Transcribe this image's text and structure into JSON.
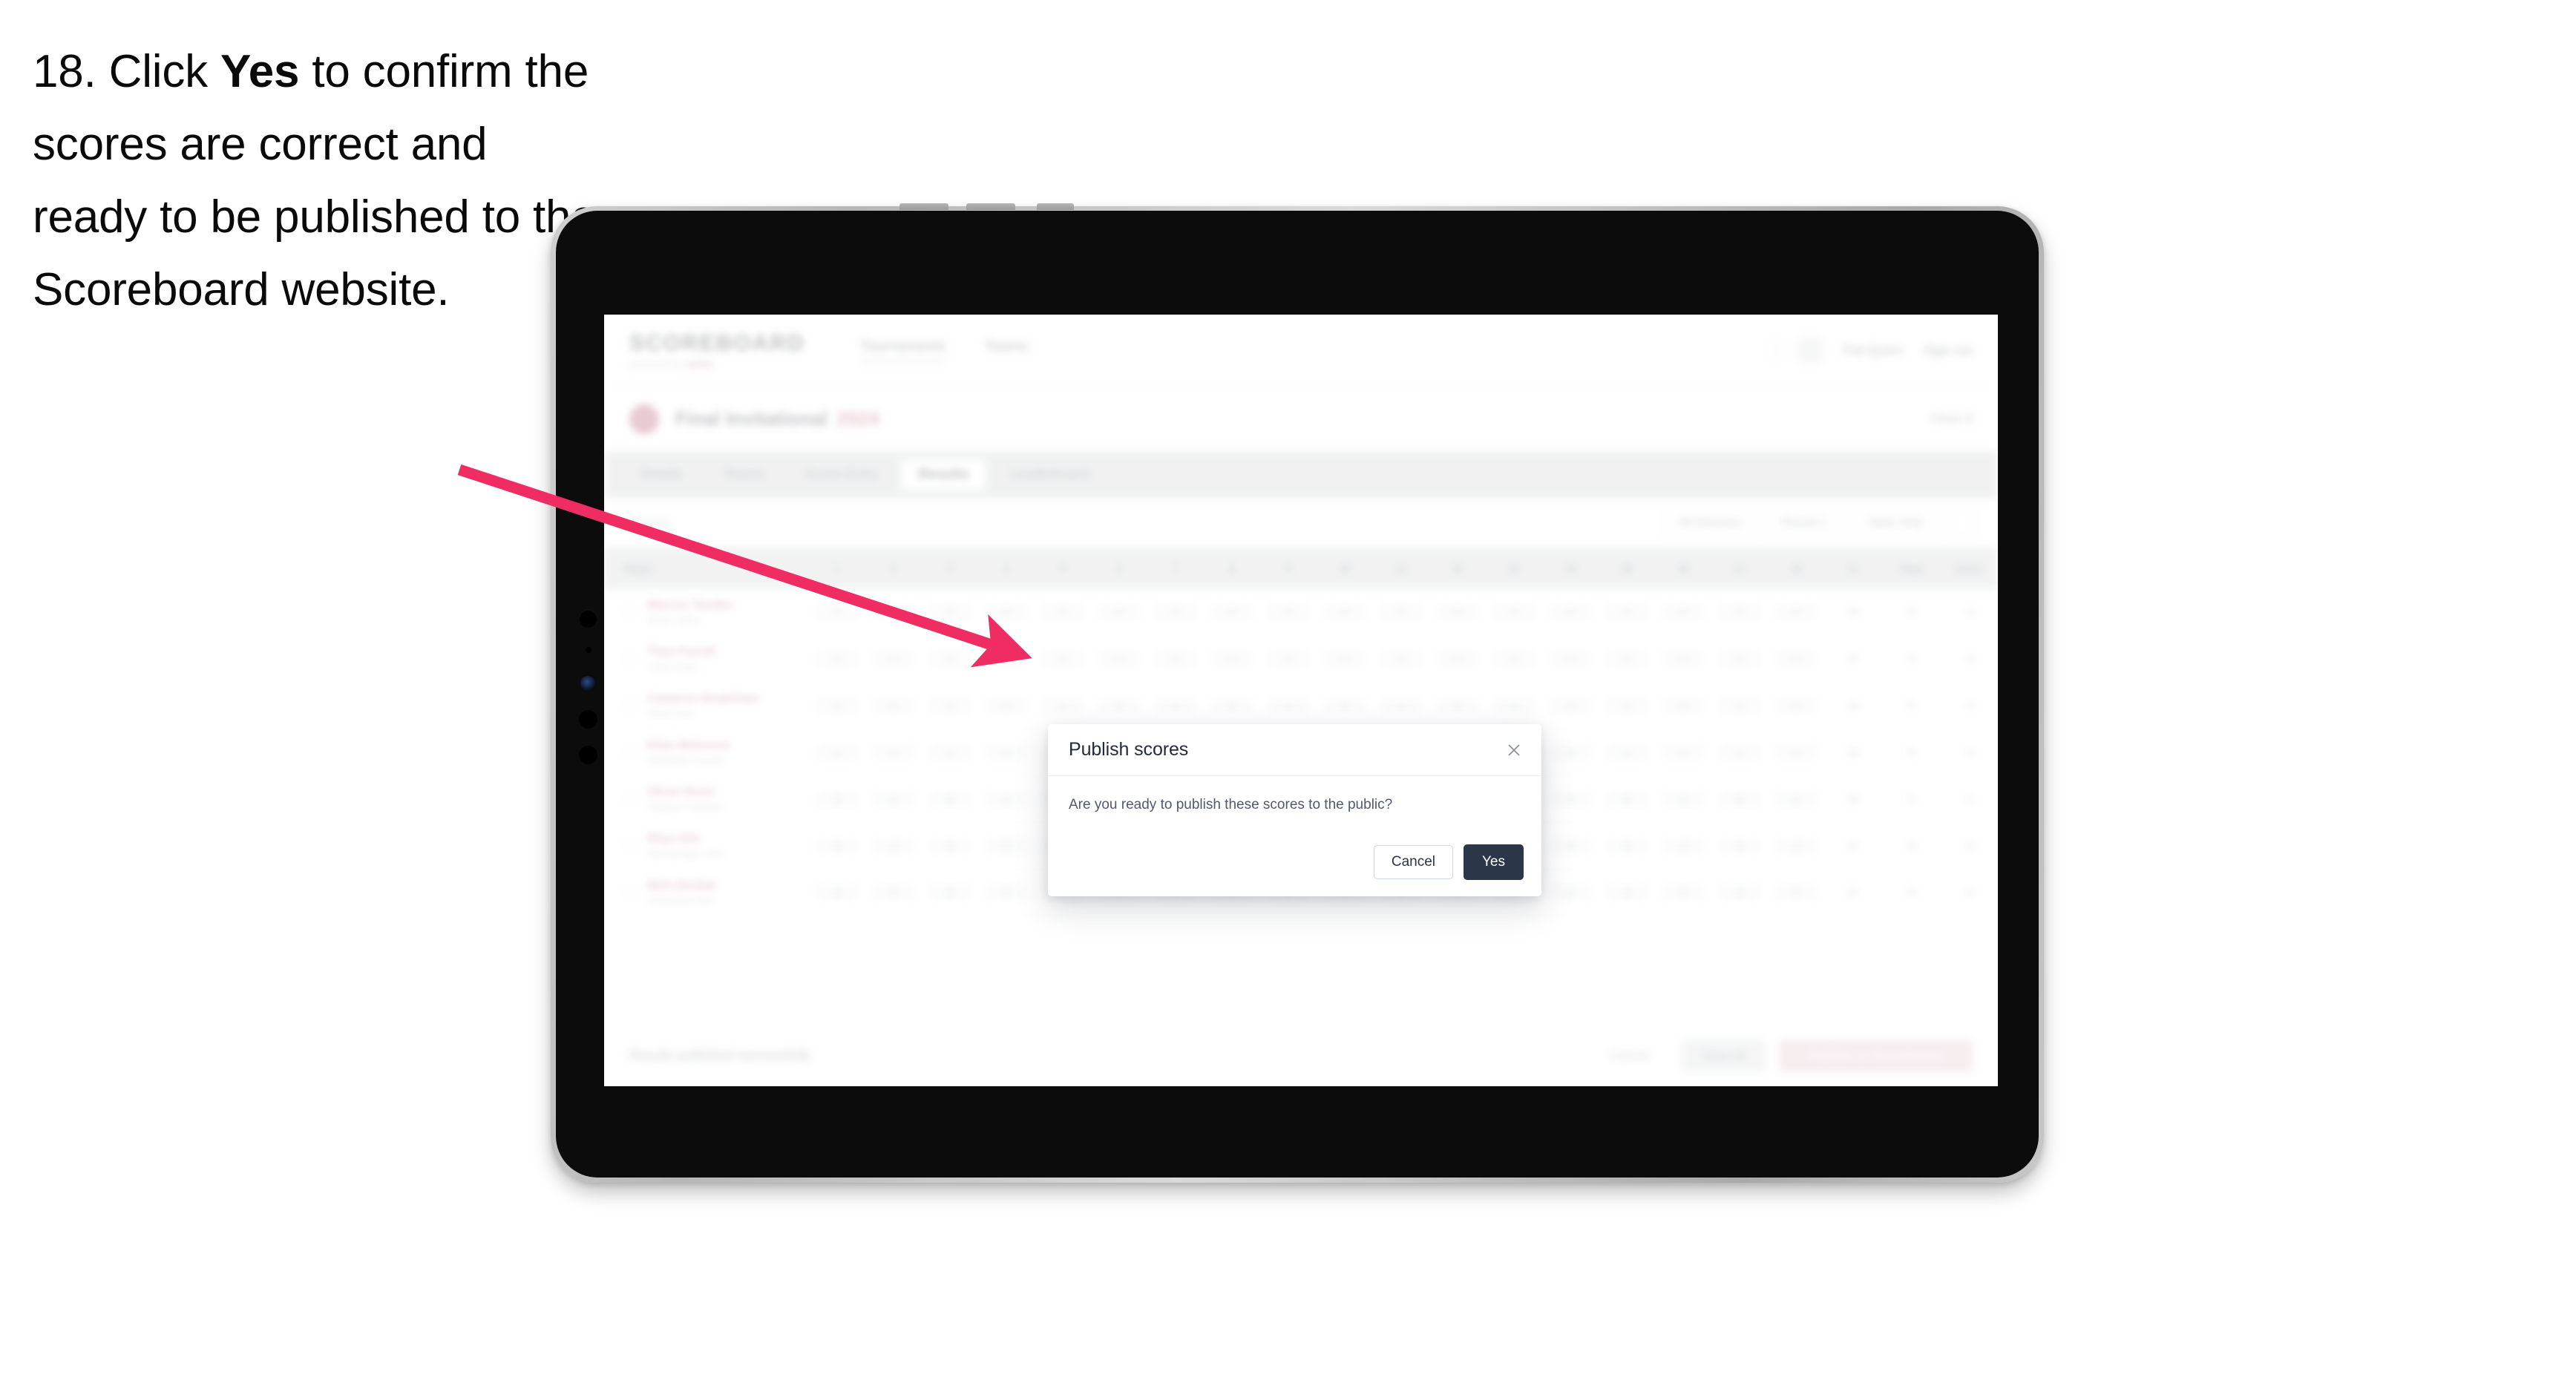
{
  "instruction": {
    "number": "18.",
    "lead": "Click",
    "emphasis": "Yes",
    "rest": "to confirm the scores are correct and ready to be published to the Scoreboard website."
  },
  "colors": {
    "arrow": "#ef2d63",
    "brand_accent": "#ef3f72",
    "primary_button": "#2b3648",
    "cancel_border": "#c9d5ea"
  },
  "device": {
    "name": "tablet",
    "buttons": [
      "volume-up",
      "volume-down",
      "power"
    ]
  },
  "app": {
    "header": {
      "brand_title": "SCOREBOARD",
      "brand_sub_prefix": "powered by",
      "brand_sub_accent": "swim",
      "nav": [
        {
          "label": "Tournaments",
          "active": true
        },
        {
          "label": "Teams",
          "active": false
        }
      ],
      "user_name": "Pat Quinn",
      "sign_out": "Sign out"
    },
    "competition": {
      "name": "Final Invitational",
      "year": "2024",
      "meta": "Heat 4"
    },
    "tabs": [
      {
        "label": "Details",
        "active": false
      },
      {
        "label": "Teams",
        "active": false
      },
      {
        "label": "Score Entry",
        "active": false
      },
      {
        "label": "Results",
        "active": true
      },
      {
        "label": "Leaderboard",
        "active": false
      }
    ],
    "filters": {
      "search_placeholder": "Search",
      "chips": [
        "All Divisions",
        "Round 1",
        "Table Only"
      ]
    },
    "table": {
      "columns": [
        "Player",
        "1",
        "2",
        "3",
        "4",
        "5",
        "6",
        "7",
        "8",
        "9",
        "10",
        "11",
        "12",
        "13",
        "14",
        "15",
        "16",
        "17",
        "18",
        "In",
        "Total",
        "Score"
      ],
      "rows": [
        {
          "name": "Marcus Tanaka",
          "club": "Ridge Valley",
          "scores": [
            "4",
            "4",
            "3",
            "4",
            "5",
            "4",
            "3",
            "4",
            "4",
            "4",
            "5",
            "3",
            "4",
            "4",
            "4",
            "4",
            "3",
            "4"
          ],
          "in": "36",
          "total": "72",
          "score": "+2"
        },
        {
          "name": "Theo Farrell",
          "club": "Lakes Edge",
          "scores": [
            "5",
            "4",
            "4",
            "3",
            "4",
            "4",
            "4",
            "5",
            "3",
            "4",
            "4",
            "4",
            "3",
            "4",
            "5",
            "4",
            "4",
            "4"
          ],
          "in": "37",
          "total": "73",
          "score": "+3"
        },
        {
          "name": "Cameron Bradshaw",
          "club": "Pines Park",
          "scores": [
            "4",
            "3",
            "4",
            "4",
            "4",
            "5",
            "4",
            "3",
            "4",
            "4",
            "4",
            "4",
            "4",
            "5",
            "3",
            "4",
            "4",
            "4"
          ],
          "in": "36",
          "total": "72",
          "score": "+2"
        },
        {
          "name": "Elias Mokoena",
          "club": "Northside Country",
          "scores": [
            "4",
            "4",
            "5",
            "4",
            "3",
            "4",
            "4",
            "4",
            "4",
            "5",
            "4",
            "3",
            "4",
            "4",
            "4",
            "4",
            "5",
            "4"
          ],
          "in": "38",
          "total": "74",
          "score": "+4"
        },
        {
          "name": "Oliver Reed",
          "club": "Harbour Crescent",
          "scores": [
            "3",
            "4",
            "4",
            "4",
            "5",
            "4",
            "4",
            "4",
            "3",
            "4",
            "4",
            "5",
            "4",
            "4",
            "4",
            "3",
            "4",
            "4"
          ],
          "in": "36",
          "total": "71",
          "score": "+1"
        },
        {
          "name": "Rhys Kitt",
          "club": "Stonebridge Links",
          "scores": [
            "4",
            "4",
            "4",
            "5",
            "4",
            "3",
            "4",
            "4",
            "4",
            "4",
            "4",
            "4",
            "5",
            "4",
            "3",
            "4",
            "4",
            "4"
          ],
          "in": "37",
          "total": "73",
          "score": "+3"
        },
        {
          "name": "Nick Dunbar",
          "club": "Greenfield Park",
          "scores": [
            "4",
            "5",
            "3",
            "4",
            "4",
            "4",
            "4",
            "4",
            "5",
            "4",
            "3",
            "4",
            "4",
            "4",
            "4",
            "4",
            "4",
            "5"
          ],
          "in": "37",
          "total": "74",
          "score": "+4"
        }
      ]
    },
    "footer": {
      "note": "Results published successfully",
      "actions": [
        {
          "label": "Cancel",
          "style": "link"
        },
        {
          "label": "Save all",
          "style": "gray"
        },
        {
          "label": "Publish to Scoreboard",
          "style": "danger"
        }
      ]
    }
  },
  "modal": {
    "title": "Publish scores",
    "message": "Are you ready to publish these scores to the public?",
    "cancel_label": "Cancel",
    "confirm_label": "Yes",
    "close_icon": "close-icon"
  }
}
